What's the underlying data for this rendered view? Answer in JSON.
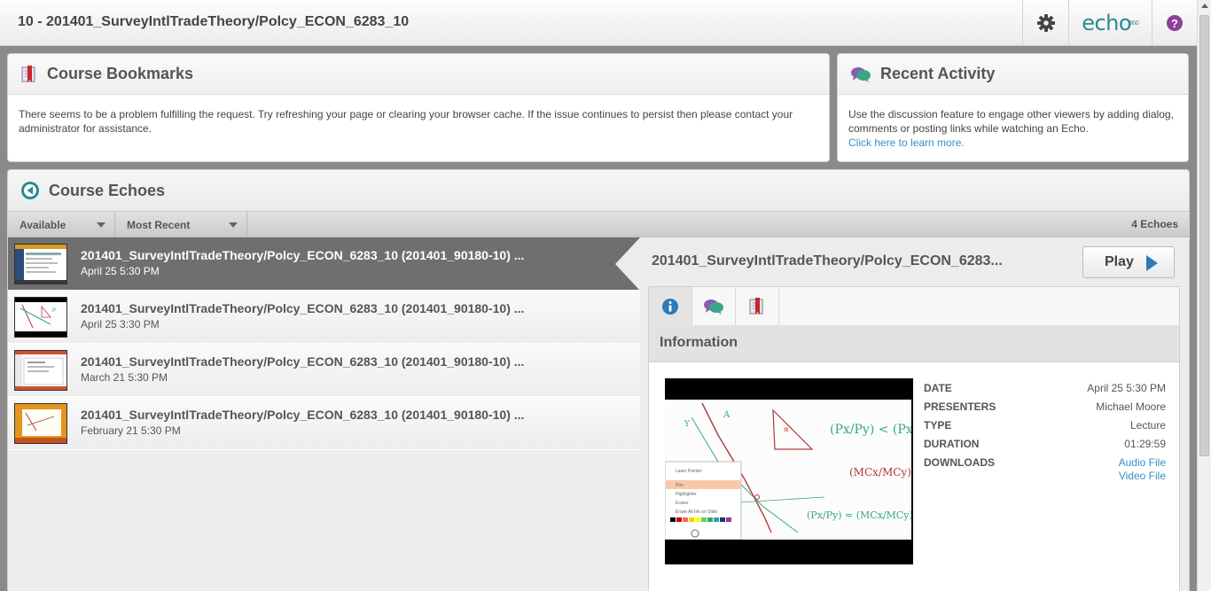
{
  "header": {
    "title": "10 - 201401_SurveyIntlTradeTheory/Polcy_ECON_6283_10",
    "logo_text": "echo",
    "logo_sup": "360",
    "help_label": "?"
  },
  "bookmarks": {
    "title": "Course Bookmarks",
    "message": "There seems to be a problem fulfilling the request. Try refreshing your page or clearing your browser cache. If the issue continues to persist then please contact your administrator for assistance."
  },
  "recent": {
    "title": "Recent Activity",
    "message": "Use the discussion feature to engage other viewers by adding dialog, comments or posting links while watching an Echo.",
    "link": "Click here to learn more."
  },
  "echoes": {
    "title": "Course Echoes",
    "filter_available": "Available",
    "filter_sort": "Most Recent",
    "count": "4 Echoes",
    "items": [
      {
        "title": "201401_SurveyIntlTradeTheory/Polcy_ECON_6283_10 (201401_90180-10) ...",
        "date": "April 25 5:30 PM"
      },
      {
        "title": "201401_SurveyIntlTradeTheory/Polcy_ECON_6283_10 (201401_90180-10) ...",
        "date": "April 25 3:30 PM"
      },
      {
        "title": "201401_SurveyIntlTradeTheory/Polcy_ECON_6283_10 (201401_90180-10) ...",
        "date": "March 21 5:30 PM"
      },
      {
        "title": "201401_SurveyIntlTradeTheory/Polcy_ECON_6283_10 (201401_90180-10) ...",
        "date": "February 21 5:30 PM"
      }
    ]
  },
  "detail": {
    "title": "201401_SurveyIntlTradeTheory/Polcy_ECON_6283...",
    "play_label": "Play",
    "section": "Information",
    "meta": {
      "date_key": "DATE",
      "date_val": "April 25 5:30 PM",
      "presenters_key": "PRESENTERS",
      "presenters_val": "Michael Moore",
      "type_key": "TYPE",
      "type_val": "Lecture",
      "duration_key": "DURATION",
      "duration_val": "01:29:59",
      "downloads_key": "DOWNLOADS",
      "audio": "Audio File",
      "video": "Video File"
    },
    "preview_menu": [
      "Laser Pointer",
      "Pen",
      "Highlighter",
      "Eraser",
      "Erase All Ink on Slide"
    ]
  },
  "colors": {
    "accent": "#2a8a8c",
    "link": "#3a8dc5",
    "play_arrow": "#2e7ab8",
    "help": "#8e3f9a",
    "active_row": "#6f6f6f"
  }
}
